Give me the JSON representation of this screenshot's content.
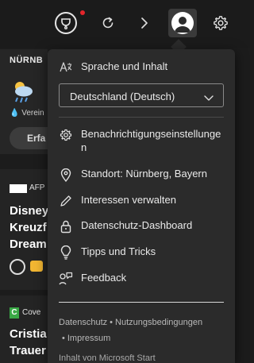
{
  "toolbar": {
    "rewards_icon": "rewards-trophy-icon",
    "refresh_icon": "refresh-icon",
    "chevron_icon": "chevron-right-icon",
    "profile_icon": "profile-avatar-icon",
    "settings_icon": "gear-icon",
    "notification_color": "#e5252b"
  },
  "background_feed": {
    "city": "NÜRNB",
    "weather_text": "Verein",
    "button_label": "Erfa",
    "card1": {
      "source": "AFP",
      "headline_lines": [
        "Disney",
        "Kreuzf",
        "Dream"
      ]
    },
    "card2": {
      "source_logo": "C",
      "source": "Cove",
      "headline_lines": [
        "Cristia",
        "Trauer"
      ]
    }
  },
  "menu": {
    "language_section_label": "Sprache und Inhalt",
    "language_select_value": "Deutschland (Deutsch)",
    "items": [
      {
        "label": "Benachrichtigungseinstellungen",
        "icon": "gear-icon"
      },
      {
        "label": "Standort: Nürnberg, Bayern",
        "icon": "location-pin-icon"
      },
      {
        "label": "Interessen verwalten",
        "icon": "pencil-icon"
      },
      {
        "label": "Datenschutz-Dashboard",
        "icon": "lock-icon"
      },
      {
        "label": "Tipps und Tricks",
        "icon": "lightbulb-icon"
      },
      {
        "label": "Feedback",
        "icon": "feedback-icon"
      }
    ],
    "footer": {
      "privacy": "Datenschutz",
      "terms": "Nutzungsbedingungen",
      "imprint": "Impressum",
      "separator": "•",
      "note": "Inhalt von Microsoft Start"
    }
  }
}
